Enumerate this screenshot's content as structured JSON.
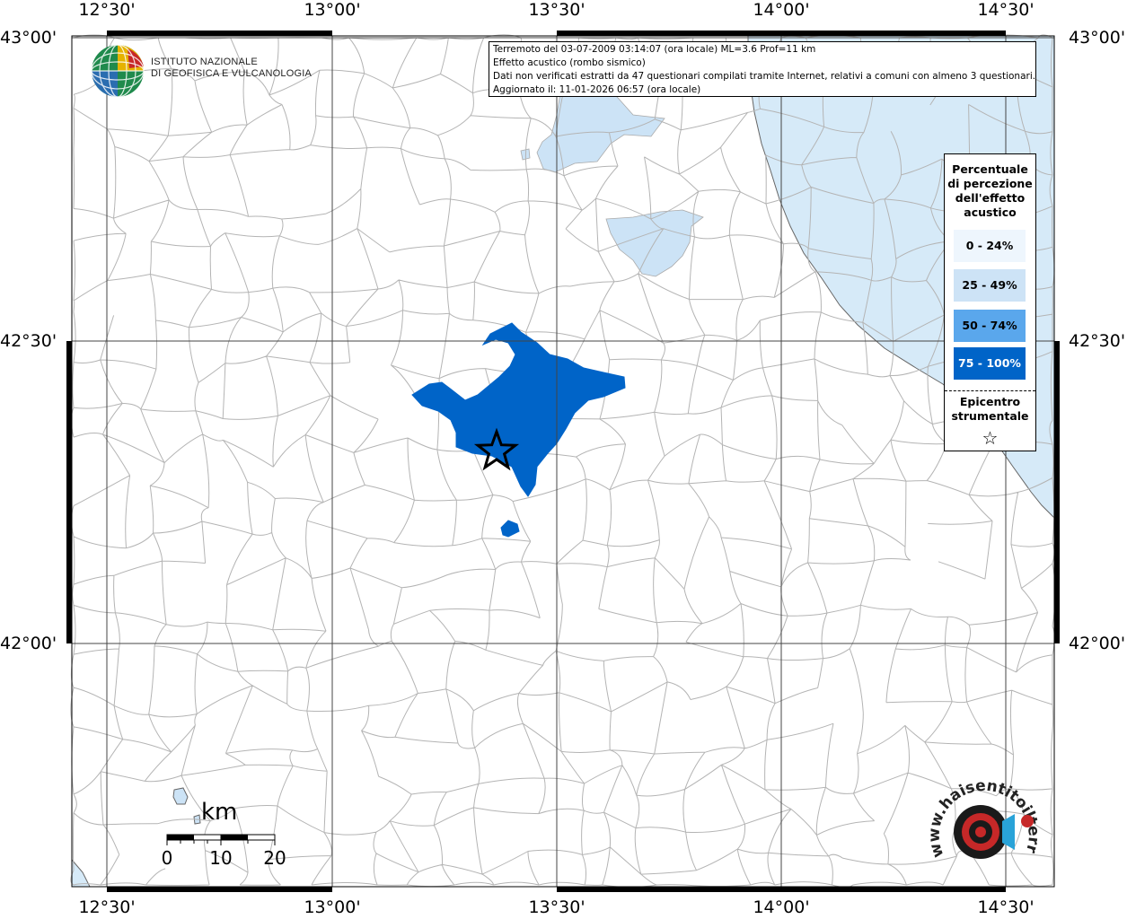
{
  "map": {
    "lon_ticks": [
      "12°30'",
      "13°00'",
      "13°30'",
      "14°00'",
      "14°30'"
    ],
    "lat_ticks": [
      "43°00'",
      "42°30'",
      "42°00'"
    ]
  },
  "info": {
    "line1": "Terremoto del 03-07-2009 03:14:07 (ora locale) ML=3.6 Prof=11 km",
    "line2": "Effetto acustico (rombo sismico)",
    "line3": "Dati non verificati estratti da 47 questionari compilati tramite Internet, relativi a comuni con almeno 3 questionari.",
    "line4": "Aggiornato il: 11-01-2026 06:57 (ora locale)"
  },
  "legend": {
    "title_lines": [
      "Percentuale",
      "di percezione",
      "dell'effetto",
      "acustico"
    ],
    "bins": [
      {
        "label": "0 - 24%",
        "color": "#eef6fd"
      },
      {
        "label": "25 - 49%",
        "color": "#cde3f6"
      },
      {
        "label": "50 - 74%",
        "color": "#5aa7ec"
      },
      {
        "label": "75 - 100%",
        "color": "#0064c8"
      }
    ],
    "epicenter_lines": [
      "Epicentro",
      "strumentale"
    ],
    "star": "☆"
  },
  "logo_ingv": {
    "line1": "ISTITUTO NAZIONALE",
    "line2": "DI GEOFISICA E VULCANOLOGIA"
  },
  "scale": {
    "unit": "km",
    "labels": [
      "0",
      "10",
      "20"
    ]
  },
  "logo_hs": {
    "text": "www.haisentitoilterremoto.it"
  },
  "colors": {
    "sea": "#d6eaf8",
    "lake": "#cce3f6",
    "felt_75_100": "#0064c8",
    "boundaries": "#b4b4b4",
    "grid": "#444444"
  }
}
